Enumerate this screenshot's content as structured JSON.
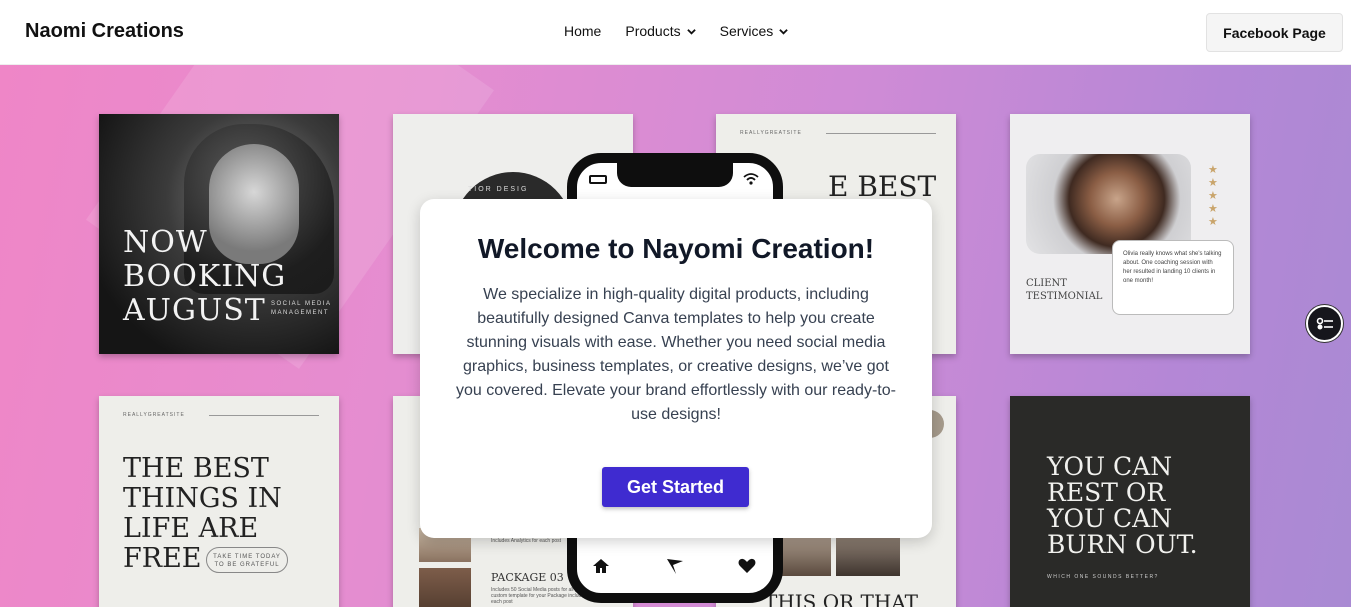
{
  "header": {
    "brand": "Naomi Creations",
    "nav": [
      {
        "label": "Home",
        "has_dropdown": false
      },
      {
        "label": "Products",
        "has_dropdown": true
      },
      {
        "label": "Services",
        "has_dropdown": true
      }
    ],
    "cta_label": "Facebook Page"
  },
  "gallery": {
    "card1": {
      "headline": "NOW\nBOOKING\nAUGUST",
      "sub": "SOCIAL MEDIA\nMANAGEMENT"
    },
    "card2": {
      "circle_text": "TIOR DESIG"
    },
    "card3": {
      "site": "REALLYGREATSITE",
      "title": "E BEST"
    },
    "card4": {
      "label": "CLIENT\nTESTIMONIAL",
      "quote": "Olivia really knows what she's talking about. One coaching session with her resulted in landing 10 clients in one month!",
      "stars": "★\n★\n★\n★\n★"
    },
    "card5": {
      "site": "REALLYGREATSITE",
      "title": "THE BEST\nTHINGS IN\nLIFE ARE\nFREE",
      "pill": "TAKE TIME TODAY\nTO BE GRATEFUL"
    },
    "card6": {
      "package": "PACKAGE 03",
      "package_text": "Includes 50 Social Media posts for all platforms and custom template for your Package includes analytics for each post",
      "line": "Includes Analytics for each post"
    },
    "card7": {
      "title": "THIS OR THAT"
    },
    "card8": {
      "title": "YOU CAN\nREST OR\nYOU CAN\nBURN OUT.",
      "sub": "WHICH ONE SOUNDS BETTER?"
    }
  },
  "welcome": {
    "heading": "Welcome to Nayomi Creation!",
    "body": "We specialize in high-quality digital products, including beautifully designed Canva templates to help you create stunning visuals with ease. Whether you need social media graphics, business templates, or creative designs, we’ve got you covered. Elevate your brand effortlessly with our ready-to-use designs!",
    "cta_label": "Get Started"
  },
  "phone": {
    "icons": [
      "home-icon",
      "send-icon",
      "heart-icon"
    ]
  },
  "accessibility": {
    "icon": "accessibility-settings-icon"
  },
  "colors": {
    "accent": "#3f2bd0",
    "hero_start": "#ef86c7",
    "hero_end": "#a98ad3"
  }
}
